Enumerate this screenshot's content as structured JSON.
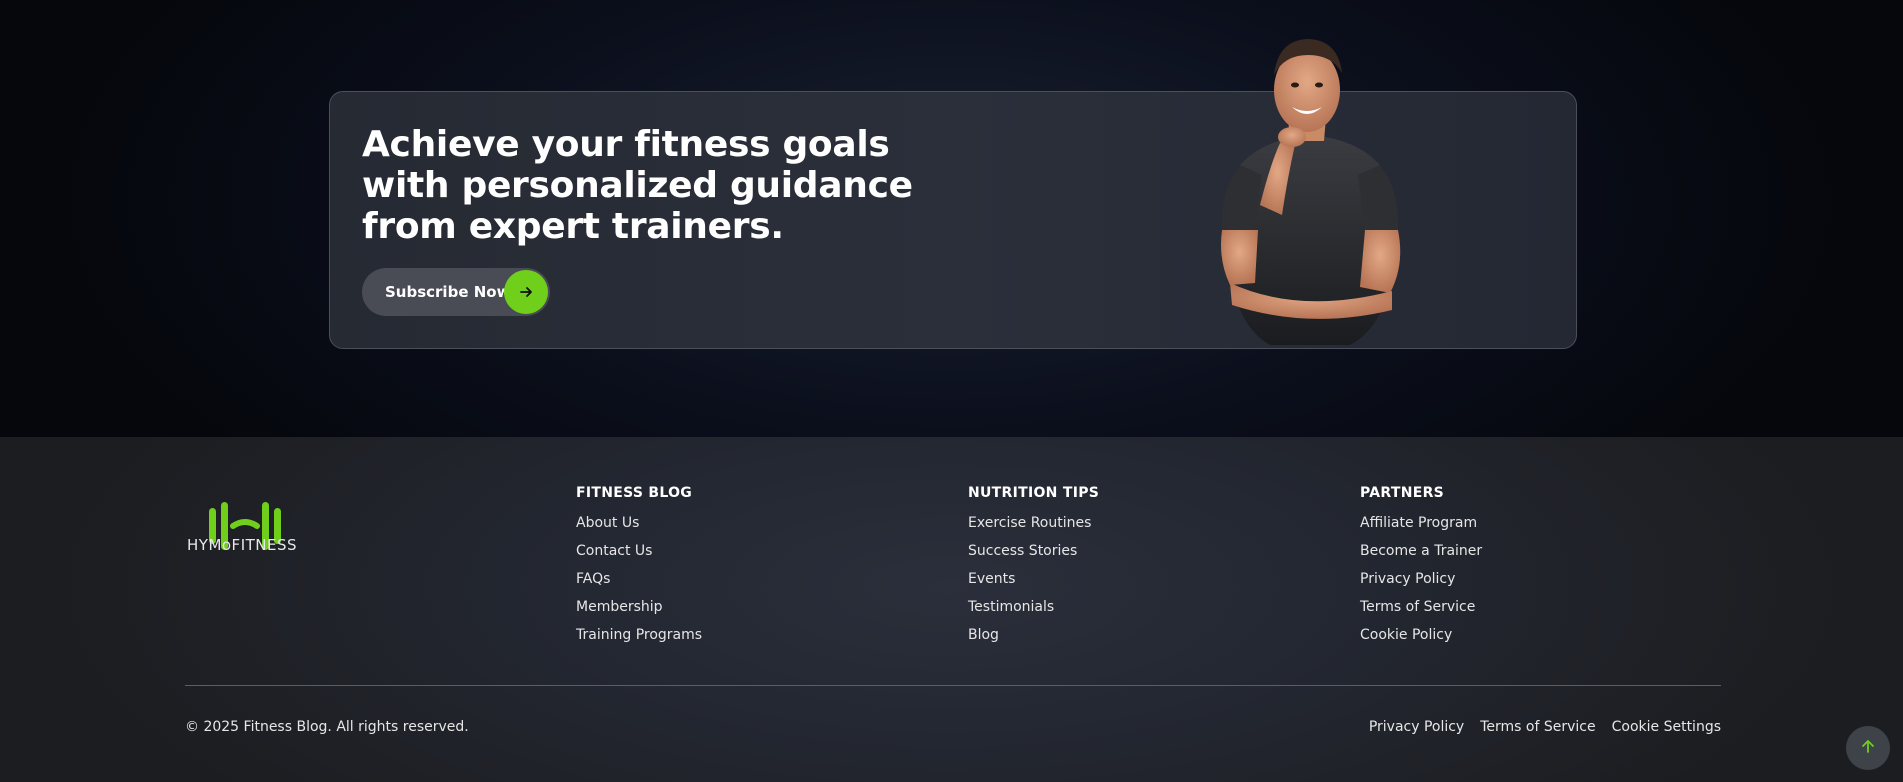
{
  "cta": {
    "title": "Achieve your fitness goals with personalized guidance from expert trainers.",
    "button_label": "Subscribe Now"
  },
  "footer": {
    "logo_text": "HYMoFITNESS",
    "columns": [
      {
        "heading": "FITNESS BLOG",
        "links": [
          "About Us",
          "Contact Us",
          "FAQs",
          "Membership",
          "Training Programs"
        ]
      },
      {
        "heading": "NUTRITION TIPS",
        "links": [
          "Exercise Routines",
          "Success Stories",
          "Events",
          "Testimonials",
          "Blog"
        ]
      },
      {
        "heading": "PARTNERS",
        "links": [
          "Affiliate Program",
          "Become a Trainer",
          "Privacy Policy",
          "Terms of Service",
          "Cookie Policy"
        ]
      }
    ],
    "copyright": "© 2025 Fitness Blog. All rights reserved.",
    "bottom_links": [
      "Privacy Policy",
      "Terms of Service",
      "Cookie Settings"
    ]
  },
  "colors": {
    "accent": "#6fcf1a",
    "card_bg": "#2b2f3a",
    "footer_bg": "#232731"
  },
  "icons": {
    "subscribe_arrow": "arrow-right-icon",
    "scroll_top": "arrow-up-icon",
    "logo": "dumbbell-logo-icon"
  }
}
